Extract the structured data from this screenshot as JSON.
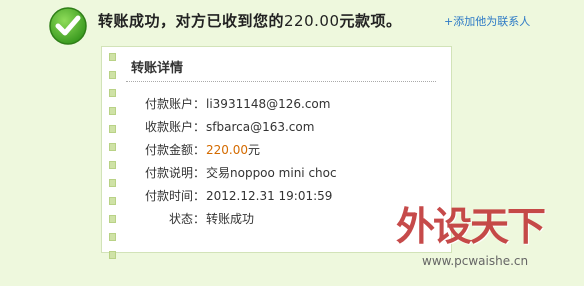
{
  "headline": {
    "part1": "转账成功，对方已收到您的",
    "amount": "220.00",
    "part2": "元款项。"
  },
  "add_contact_link": "+添加他为联系人",
  "card": {
    "title": "转账详情",
    "rows": [
      {
        "label": "付款账户：",
        "value": "li3931148@126.com"
      },
      {
        "label": "收款账户：",
        "value": "sfbarca@163.com"
      },
      {
        "label": "付款金额：",
        "amount": "220.00",
        "suffix": "元"
      },
      {
        "label": "付款说明：",
        "value": "交易noppoo mini choc"
      },
      {
        "label": "付款时间：",
        "value": "2012.12.31 19:01:59"
      },
      {
        "label": "状态：",
        "value": "转账成功"
      }
    ]
  },
  "watermark": {
    "logo": "外设天下",
    "url": "www.pcwaishe.cn"
  },
  "colors": {
    "background": "#eef8dd",
    "link": "#2d7ac6",
    "amount": "#d46b00",
    "success": "#4caf2a",
    "watermark": "#c23b3b"
  }
}
